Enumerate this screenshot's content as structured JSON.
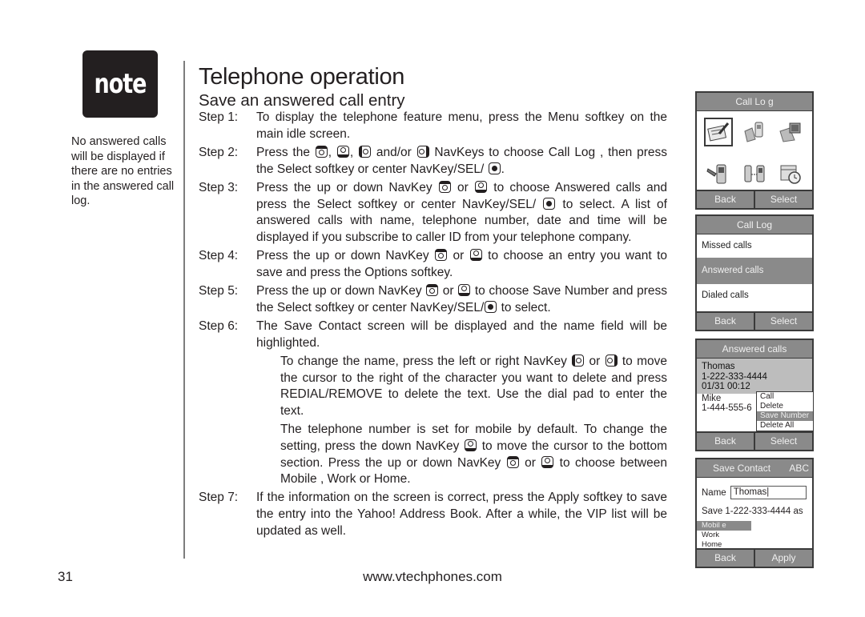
{
  "sidebar": {
    "badge_label": "note",
    "note_text": "No answered calls will be displayed if there are no entries in the answered call log."
  },
  "header": {
    "title": "Telephone operation",
    "subtitle": "Save an answered call entry"
  },
  "steps": [
    {
      "label": "Step 1:",
      "parts": [
        "To display the telephone feature menu, press the Menu softkey on the main idle screen."
      ]
    },
    {
      "label": "Step 2:",
      "parts": [
        "Press the ",
        ", ",
        ", ",
        " and/or ",
        " NavKeys to choose Call Log , then press the Select softkey or center NavKey/SEL/ ",
        "."
      ]
    },
    {
      "label": "Step 3:",
      "parts": [
        "Press the up or down NavKey ",
        " or ",
        " to choose Answered calls and press the Select softkey or center NavKey/SEL/ ",
        " to select. A list of answered calls with name, telephone number, date and time will be displayed if you subscribe to caller ID from your telephone company."
      ]
    },
    {
      "label": "Step 4:",
      "parts": [
        "Press the up or down NavKey ",
        " or ",
        " to choose an entry you want to save and press the Options softkey."
      ]
    },
    {
      "label": "Step 5:",
      "parts": [
        "Press the up or down NavKey ",
        " or ",
        " to choose Save Number and press the Select softkey or center NavKey/SEL/",
        " to select."
      ]
    },
    {
      "label": "Step 6:",
      "parts": [
        "The Save Contact screen will be displayed and the name field will be highlighted."
      ]
    },
    {
      "label": "Step 7:",
      "parts": [
        "If the information on the screen is correct, press the Apply softkey to save the entry into the Yahoo! Address Book. After a while, the VIP list will be updated as well."
      ]
    }
  ],
  "step6_paragraphs": [
    {
      "parts": [
        "To change the name, press the left or right NavKey ",
        " or ",
        " to move the cursor to the right of the character you want to delete and press REDIAL/REMOVE to delete the text. Use the dial pad to enter the text."
      ]
    },
    {
      "parts": [
        "The telephone number is set for mobile by default. To change the setting, press the down NavKey ",
        " to move the cursor to the bottom section. Press the up or down NavKey ",
        " or ",
        " to choose between Mobile , Work or Home."
      ]
    }
  ],
  "footer": {
    "page_number": "31",
    "url": "www.vtechphones.com"
  },
  "screens": {
    "call_log_menu": {
      "title": "Call Lo g",
      "icons": [
        "call-log-notepad-icon",
        "folder-phone-icon",
        "folder-photo-icon",
        "phone-settings-icon",
        "phone-transfer-icon",
        "calendar-clock-icon"
      ],
      "selected_index": 0,
      "softkey_left": "Back",
      "softkey_right": "Select"
    },
    "call_log_list": {
      "title": "Call Log",
      "items": [
        "Missed calls",
        "Answered calls",
        "Dialed calls"
      ],
      "selected": "Answered calls",
      "softkey_left": "Back",
      "softkey_right": "Select"
    },
    "answered_calls": {
      "title": "Answered calls",
      "entries": [
        {
          "name": "Thomas",
          "number": "1-222-333-4444",
          "datetime": "01/31 00:12"
        },
        {
          "name": "Mike",
          "number": "1-444-555-6"
        }
      ],
      "options_menu": [
        "Call",
        "Delete",
        "Save Number",
        "Delete All"
      ],
      "options_selected": "Save Number",
      "softkey_left": "Back",
      "softkey_right": "Select"
    },
    "save_contact": {
      "title": "Save Contact",
      "mode": "ABC",
      "name_label": "Name",
      "name_value": "Thomas|",
      "save_as_text": "Save 1-222-333-4444 as",
      "types": [
        "Mobil e",
        "Work",
        "Home"
      ],
      "selected_type": "Mobil e",
      "softkey_left": "Back",
      "softkey_right": "Apply"
    }
  },
  "colors": {
    "text": "#231f20",
    "screen_bar": "#8a8a8a",
    "screen_border": "#3a3a3a",
    "highlight_entry": "#bdbdbd"
  }
}
